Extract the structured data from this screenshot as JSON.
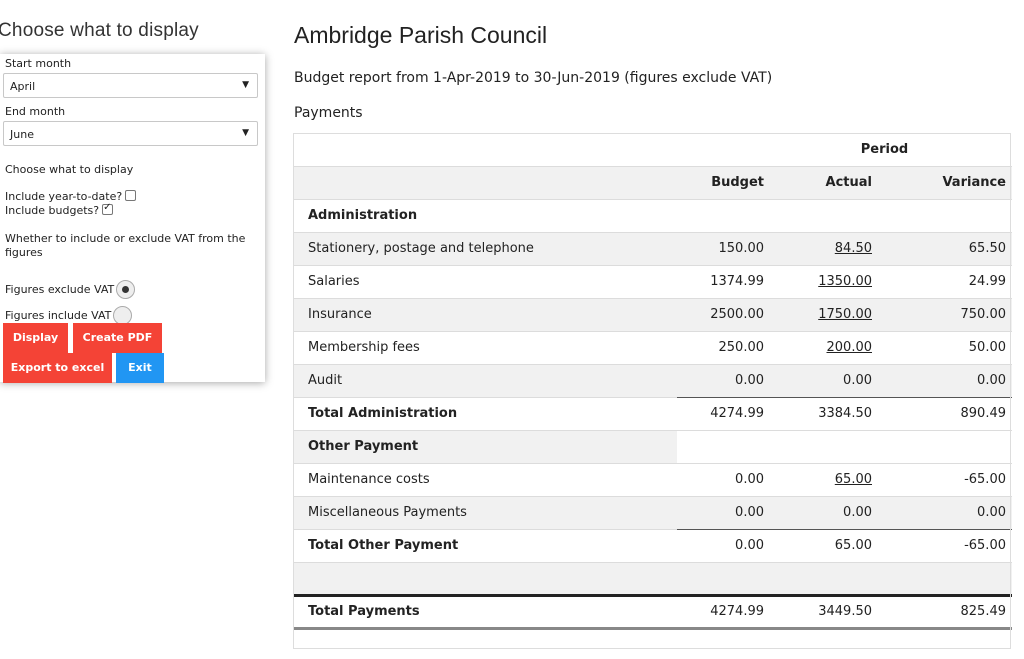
{
  "sidebar": {
    "heading": "Choose what to display",
    "start_month_label": "Start month",
    "start_month_value": "April",
    "end_month_label": "End month",
    "end_month_value": "June",
    "choose_label": "Choose what to display",
    "ytd_label": "Include year-to-date?",
    "ytd_checked": false,
    "budgets_label": "Include budgets?",
    "budgets_checked": true,
    "vat_help": "Whether to include or exclude VAT from the figures",
    "vat_exclude_label": "Figures exclude VAT",
    "vat_include_label": "Figures include VAT",
    "buttons": {
      "display": "Display",
      "create_pdf": "Create PDF",
      "export_excel": "Export to excel",
      "exit": "Exit"
    },
    "colors": {
      "red_button": "#f44336",
      "blue_button": "#2196f3"
    }
  },
  "report": {
    "title": "Ambridge Parish Council",
    "subtitle": "Budget report from 1-Apr-2019 to 30-Jun-2019 (figures exclude VAT)",
    "section": "Payments",
    "period_header": "Period",
    "columns": [
      "Budget",
      "Actual",
      "Variance"
    ],
    "groups": [
      {
        "name": "Administration",
        "rows": [
          {
            "label": "Stationery, postage and telephone",
            "budget": "150.00",
            "actual": "84.50",
            "variance": "65.50"
          },
          {
            "label": "Salaries",
            "budget": "1374.99",
            "actual": "1350.00",
            "variance": "24.99"
          },
          {
            "label": "Insurance",
            "budget": "2500.00",
            "actual": "1750.00",
            "variance": "750.00"
          },
          {
            "label": "Membership fees",
            "budget": "250.00",
            "actual": "200.00",
            "variance": "50.00"
          },
          {
            "label": "Audit",
            "budget": "0.00",
            "actual": "0.00",
            "variance": "0.00"
          }
        ],
        "total": {
          "label": "Total Administration",
          "budget": "4274.99",
          "actual": "3384.50",
          "variance": "890.49"
        }
      },
      {
        "name": "Other Payment",
        "rows": [
          {
            "label": "Maintenance costs",
            "budget": "0.00",
            "actual": "65.00",
            "variance": "-65.00"
          },
          {
            "label": "Miscellaneous Payments",
            "budget": "0.00",
            "actual": "0.00",
            "variance": "0.00"
          }
        ],
        "total": {
          "label": "Total Other Payment",
          "budget": "0.00",
          "actual": "65.00",
          "variance": "-65.00"
        }
      }
    ],
    "grand_total": {
      "label": "Total Payments",
      "budget": "4274.99",
      "actual": "3449.50",
      "variance": "825.49"
    }
  }
}
